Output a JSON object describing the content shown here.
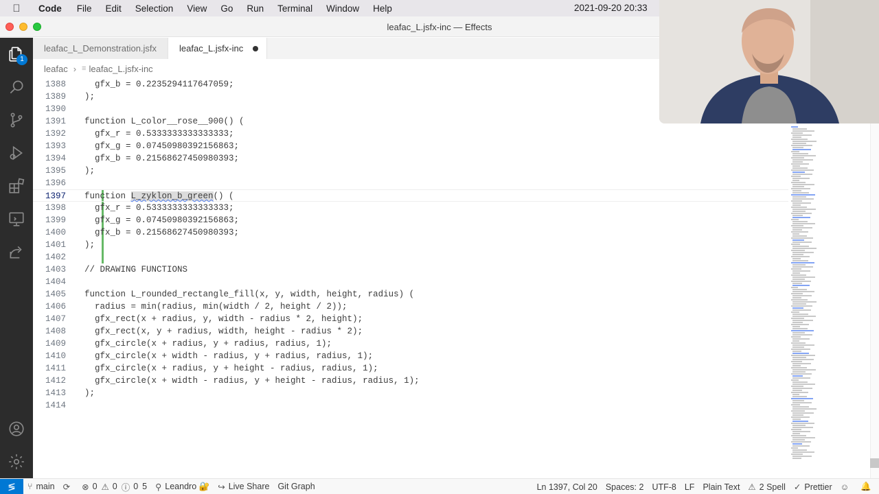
{
  "menubar": {
    "apple_icon": "apple-logo-icon",
    "app_name": "Code",
    "items": [
      "File",
      "Edit",
      "Selection",
      "View",
      "Go",
      "Run",
      "Terminal",
      "Window",
      "Help"
    ],
    "clock": "2021-09-20  20:33"
  },
  "window": {
    "title": "leafac_L.jsfx-inc — Effects"
  },
  "activity_bar": {
    "explorer_badge": "1",
    "icons": [
      "explorer-icon",
      "search-icon",
      "source-control-icon",
      "run-debug-icon",
      "extensions-icon",
      "remote-explorer-icon",
      "live-share-icon",
      "accounts-icon",
      "settings-gear-icon"
    ]
  },
  "tabs": [
    {
      "label": "leafac_L_Demonstration.jsfx"
    },
    {
      "label": "leafac_L.jsfx-inc"
    }
  ],
  "breadcrumb": {
    "folder": "leafac",
    "file": "leafac_L.jsfx-inc"
  },
  "editor": {
    "lines": [
      {
        "n": "1388",
        "code": "  gfx_b = 0.2235294117647059;"
      },
      {
        "n": "1389",
        "code": ");"
      },
      {
        "n": "1390",
        "code": ""
      },
      {
        "n": "1391",
        "code": "function L_color__rose__900() ("
      },
      {
        "n": "1392",
        "code": "  gfx_r = 0.5333333333333333;"
      },
      {
        "n": "1393",
        "code": "  gfx_g = 0.07450980392156863;"
      },
      {
        "n": "1394",
        "code": "  gfx_b = 0.21568627450980393;"
      },
      {
        "n": "1395",
        "code": ");"
      },
      {
        "n": "1396",
        "code": ""
      },
      {
        "n": "1397",
        "code_before": "function ",
        "code_highlight": "L_zyklon_b_green",
        "code_after": "() ("
      },
      {
        "n": "1398",
        "code": "  gfx_r = 0.5333333333333333;"
      },
      {
        "n": "1399",
        "code": "  gfx_g = 0.07450980392156863;"
      },
      {
        "n": "1400",
        "code": "  gfx_b = 0.21568627450980393;"
      },
      {
        "n": "1401",
        "code": ");"
      },
      {
        "n": "1402",
        "code": ""
      },
      {
        "n": "1403",
        "code": "// DRAWING FUNCTIONS"
      },
      {
        "n": "1404",
        "code": ""
      },
      {
        "n": "1405",
        "code": "function L_rounded_rectangle_fill(x, y, width, height, radius) ("
      },
      {
        "n": "1406",
        "code": "  radius = min(radius, min(width / 2, height / 2));"
      },
      {
        "n": "1407",
        "code": "  gfx_rect(x + radius, y, width - radius * 2, height);"
      },
      {
        "n": "1408",
        "code": "  gfx_rect(x, y + radius, width, height - radius * 2);"
      },
      {
        "n": "1409",
        "code": "  gfx_circle(x + radius, y + radius, radius, 1);"
      },
      {
        "n": "1410",
        "code": "  gfx_circle(x + width - radius, y + radius, radius, 1);"
      },
      {
        "n": "1411",
        "code": "  gfx_circle(x + radius, y + height - radius, radius, 1);"
      },
      {
        "n": "1412",
        "code": "  gfx_circle(x + width - radius, y + height - radius, radius, 1);"
      },
      {
        "n": "1413",
        "code": ");"
      },
      {
        "n": "1414",
        "code": ""
      }
    ]
  },
  "statusbar": {
    "branch": "main",
    "errors": "0",
    "warnings": "0",
    "info": "0",
    "ports": "5",
    "user": "Leandro 🔐",
    "live_share": "Live Share",
    "git_graph": "Git Graph",
    "cursor": "Ln 1397, Col 20",
    "indent": "Spaces: 2",
    "encoding": "UTF-8",
    "eol": "LF",
    "language": "Plain Text",
    "spell": "2 Spell",
    "prettier": "Prettier"
  },
  "colors": {
    "accent": "#0078d4",
    "git_modified": "#66b966",
    "activity_bar_bg": "#2c2c2c"
  }
}
